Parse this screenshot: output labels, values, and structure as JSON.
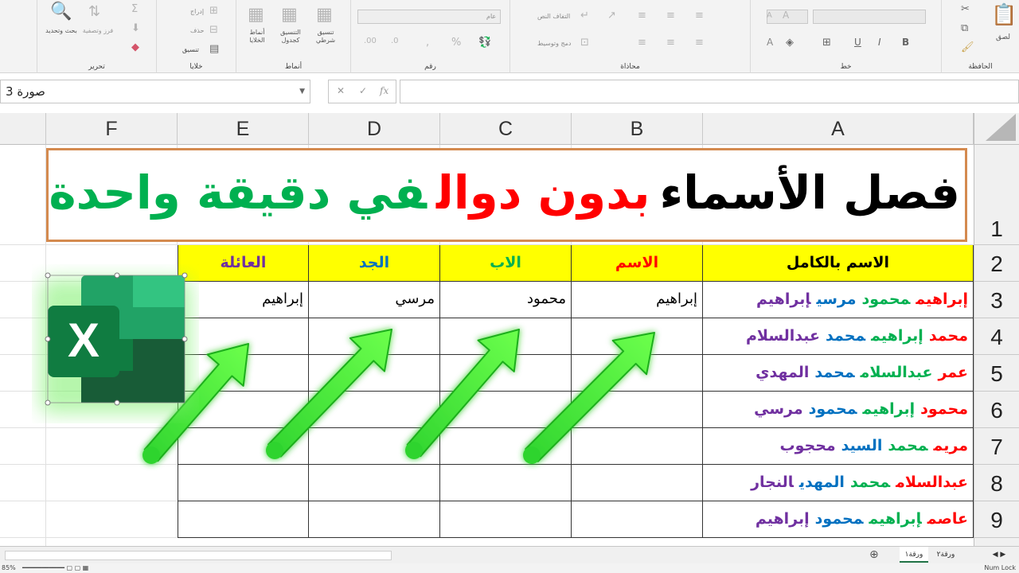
{
  "ribbon": {
    "groups": {
      "clipboard": "الحافظة",
      "font": "خط",
      "alignment": "محاذاة",
      "number": "رقم",
      "styles": "أنماط",
      "cells": "خلايا",
      "editing": "تحرير"
    },
    "buttons": {
      "paste": "لصق",
      "wrap_text": "التفاف النص",
      "merge_center": "دمج وتوسيط",
      "number_format": "عام",
      "conditional_formatting": "تنسيق شرطي",
      "format_as_table": "التنسيق كجدول",
      "cell_styles": "أنماط الخلايا",
      "insert": "إدراج",
      "delete": "حذف",
      "format": "تنسيق",
      "sort_filter": "فرز وتصفية",
      "find_select": "بحث وتحديد"
    }
  },
  "formula_bar": {
    "name_box": "صورة 3",
    "fx": "fx",
    "formula": ""
  },
  "columns": [
    "A",
    "B",
    "C",
    "D",
    "E",
    "F"
  ],
  "rows": [
    "1",
    "2",
    "3",
    "4",
    "5",
    "6",
    "7",
    "8",
    "9"
  ],
  "title": {
    "part1": "فصل الأسماء",
    "part2": "بدون دوال",
    "part3": "في دقيقة واحدة",
    "color1": "#000000",
    "color2": "#ff0000",
    "color3": "#00b050"
  },
  "table": {
    "headers": [
      {
        "text": "الاسم بالكامل",
        "color": "#000000"
      },
      {
        "text": "الاسم",
        "color": "#ff0000"
      },
      {
        "text": "الاب",
        "color": "#00b050"
      },
      {
        "text": "الجد",
        "color": "#0070c0"
      },
      {
        "text": "العائلة",
        "color": "#7030a0"
      }
    ],
    "full_names": [
      [
        "إبراهيم",
        "محمود",
        "مرسي",
        "إبراهيم"
      ],
      [
        "محمد",
        "إبراهيم",
        "محمد",
        "عبدالسلام"
      ],
      [
        "عمر",
        "عبدالسلام",
        "محمد",
        "المهدي"
      ],
      [
        "محمود",
        "إبراهيم",
        "محمود",
        "مرسي"
      ],
      [
        "مريم",
        "محمد",
        "السيد",
        "محجوب"
      ],
      [
        "عبدالسلام",
        "محمد",
        "المهدي",
        "النجار"
      ],
      [
        "عاصم",
        "إبراهيم",
        "محمود",
        "إبراهيم"
      ]
    ],
    "name_colors": [
      "#ff0000",
      "#00b050",
      "#0070c0",
      "#7030a0"
    ],
    "split_row": [
      "إبراهيم",
      "محمود",
      "مرسي",
      "إبراهيم"
    ]
  },
  "logo": {
    "letter": "X",
    "icon": "excel-logo-icon"
  },
  "sheet_tabs": [
    "ورقة١",
    "ورقة٢"
  ],
  "status": {
    "zoom": "85%",
    "num_lock": "Num Lock"
  }
}
